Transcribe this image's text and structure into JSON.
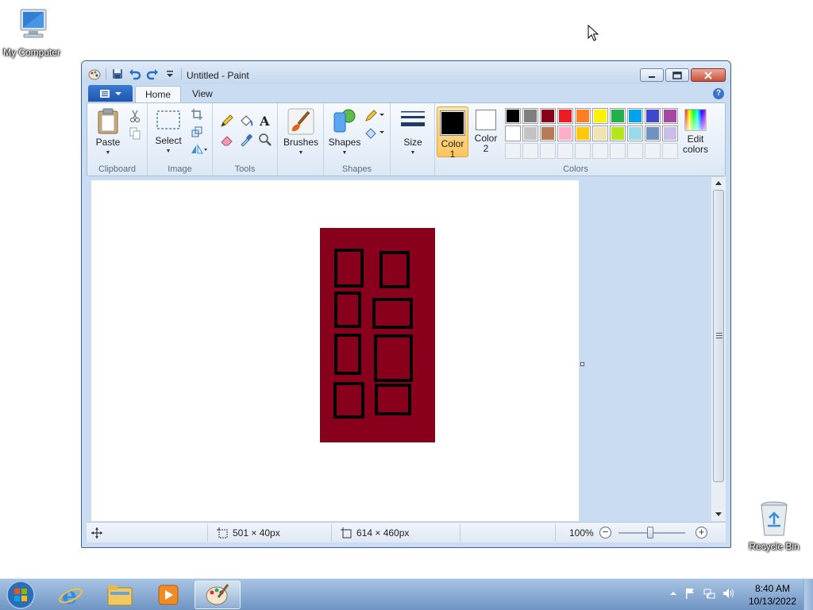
{
  "desktop": {
    "icons": [
      {
        "label": "My Computer"
      },
      {
        "label": "Recycle Bin"
      }
    ]
  },
  "window": {
    "title": "Untitled - Paint",
    "tabs": [
      "Home",
      "View"
    ],
    "ribbon": {
      "clipboard": {
        "paste": "Paste",
        "group": "Clipboard"
      },
      "image": {
        "select": "Select",
        "group": "Image"
      },
      "tools": {
        "group": "Tools"
      },
      "brushes": {
        "label": "Brushes"
      },
      "shapes": {
        "label": "Shapes",
        "group": "Shapes"
      },
      "size": {
        "label": "Size"
      },
      "colors": {
        "color1_label": "Color",
        "color1_num": "1",
        "color2_label": "Color",
        "color2_num": "2",
        "edit_colors_line1": "Edit",
        "edit_colors_line2": "colors",
        "group": "Colors",
        "color1": "#000000",
        "color2": "#ffffff",
        "palette_row1": [
          "#000000",
          "#7f7f7f",
          "#880015",
          "#ed1c24",
          "#ff7f27",
          "#fff200",
          "#22b14c",
          "#00a2e8",
          "#3f48cc",
          "#a349a4"
        ],
        "palette_row2": [
          "#ffffff",
          "#c3c3c3",
          "#b97a57",
          "#ffaec9",
          "#ffc90e",
          "#efe4b0",
          "#b5e61d",
          "#99d9ea",
          "#7092be",
          "#c8bfe7"
        ]
      }
    },
    "canvas": {
      "door_color": "#88001b",
      "panel_border": "#000000"
    },
    "status": {
      "selection_size": "501 × 40px",
      "canvas_size": "614 × 460px",
      "zoom": "100%"
    }
  },
  "taskbar": {
    "time": "8:40 AM",
    "date": "10/13/2022"
  }
}
